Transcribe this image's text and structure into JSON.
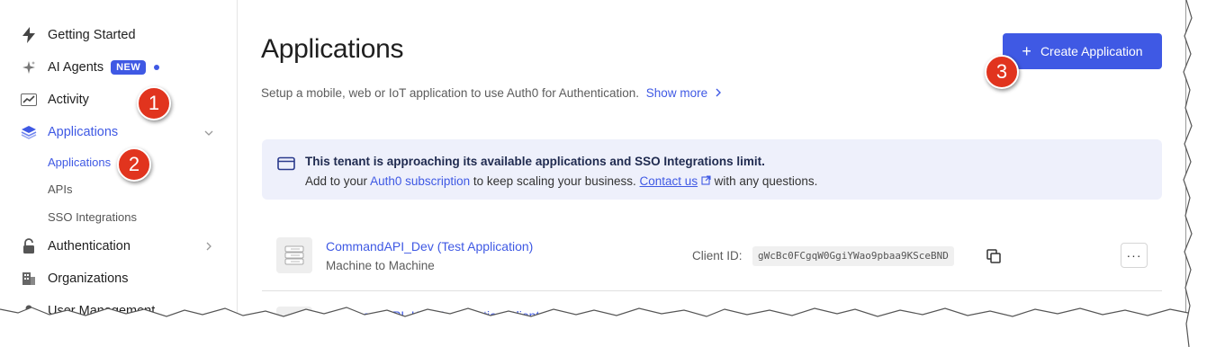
{
  "sidebar": {
    "items": [
      {
        "label": "Getting Started",
        "icon": "bolt-icon"
      },
      {
        "label": "AI Agents",
        "badge": "NEW",
        "icon": "sparkle-icon"
      },
      {
        "label": "Activity",
        "icon": "activity-icon"
      },
      {
        "label": "Applications",
        "icon": "layers-icon"
      },
      {
        "label": "Authentication",
        "icon": "lock-icon"
      },
      {
        "label": "Organizations",
        "icon": "building-icon"
      },
      {
        "label": "User Management",
        "icon": "user-icon"
      }
    ],
    "sub_items": [
      "Applications",
      "APIs",
      "SSO Integrations"
    ]
  },
  "main": {
    "title": "Applications",
    "subtitle": "Setup a mobile, web or IoT application to use Auth0 for Authentication.",
    "show_more": "Show more",
    "create_button": "Create Application",
    "banner": {
      "title": "This tenant is approaching its available applications and SSO Integrations limit.",
      "text_1": "Add to your",
      "link_1": "Auth0 subscription",
      "text_2": "to keep scaling your business.",
      "link_2": "Contact us",
      "text_3": "with any questions."
    },
    "apps": [
      {
        "name": "CommandAPI_Dev (Test Application)",
        "type": "Machine to Machine",
        "client_id_label": "Client ID:",
        "client_id": "gWcBc0FCgqW0GgiYWao9pbaa9KSceBND"
      },
      {
        "name": "CommandAPI_Key Registration Client"
      }
    ],
    "more_label": "···"
  },
  "steps": [
    "1",
    "2",
    "3"
  ],
  "colors": {
    "accent": "#3f59e4",
    "step": "#e1341e"
  }
}
